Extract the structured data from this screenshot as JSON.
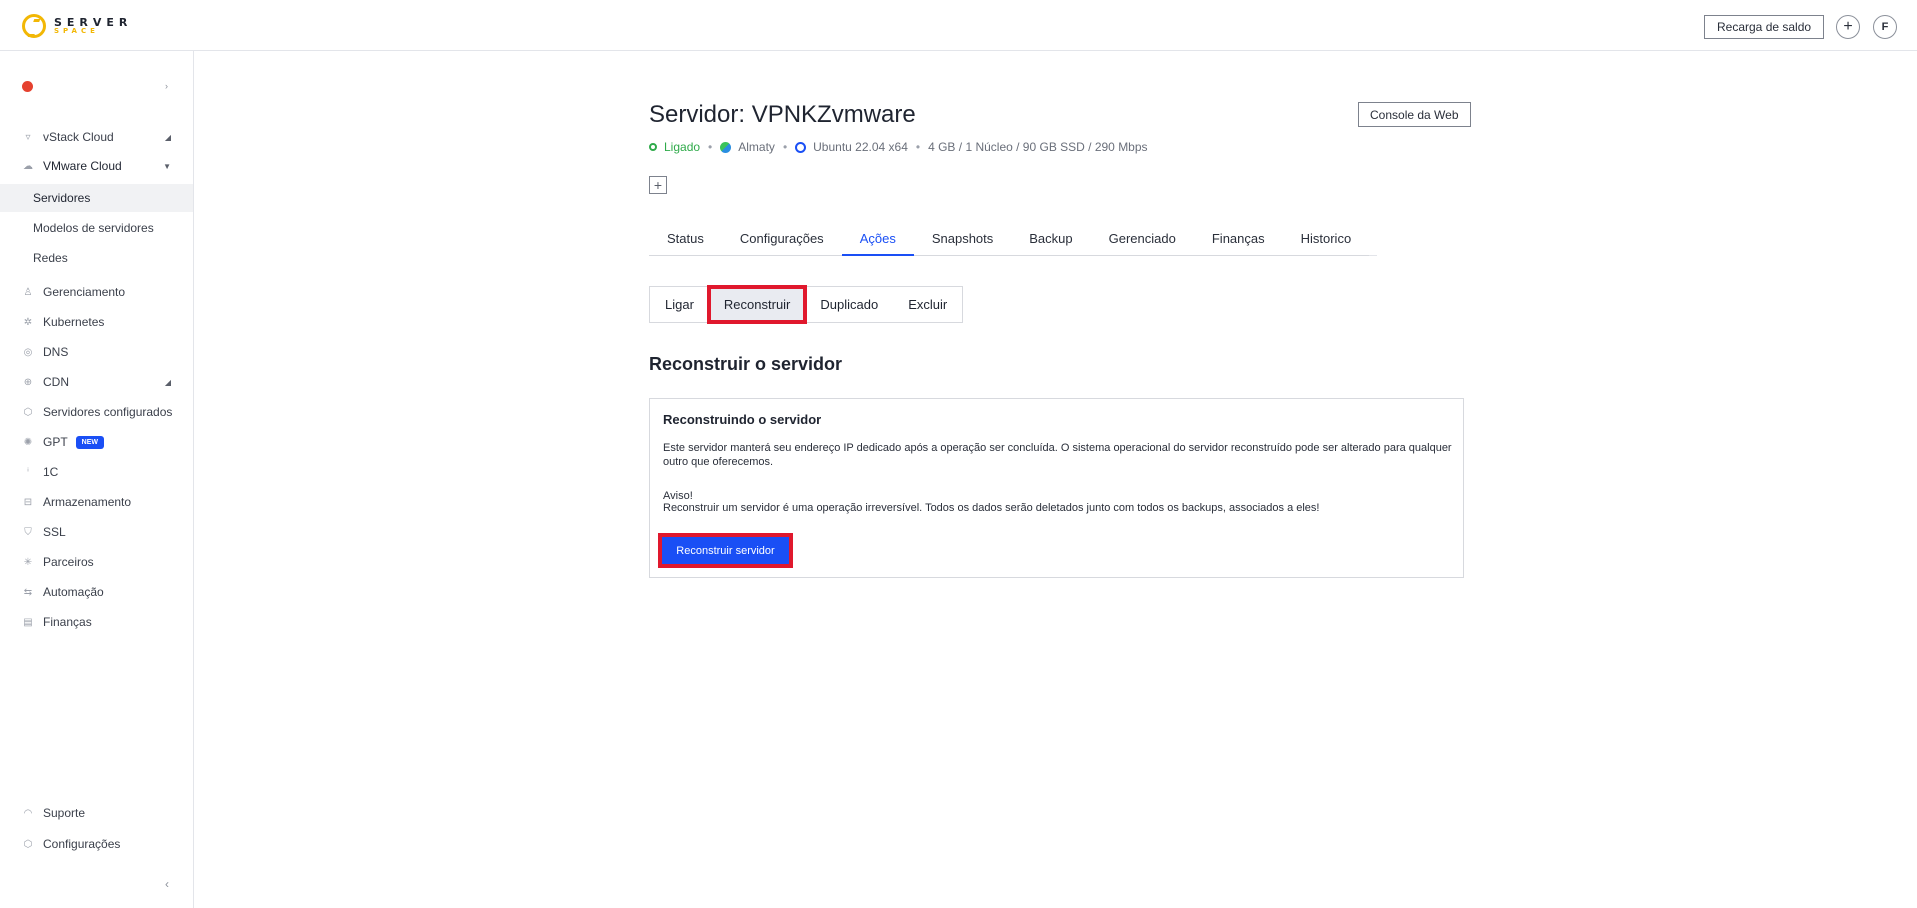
{
  "header": {
    "logo_top": "SERVER",
    "logo_bottom": "SPACE",
    "recharge_label": "Recarga de saldo",
    "plus_symbol": "+",
    "avatar_initial": "F"
  },
  "sidebar": {
    "items": [
      {
        "label": "vStack Cloud",
        "icon": "vstack-icon"
      },
      {
        "label": "VMware Cloud",
        "icon": "cloud-icon"
      },
      {
        "label": "Servidores"
      },
      {
        "label": "Modelos de servidores"
      },
      {
        "label": "Redes"
      },
      {
        "label": "Gerenciamento",
        "icon": "user-icon"
      },
      {
        "label": "Kubernetes",
        "icon": "kubernetes-icon"
      },
      {
        "label": "DNS",
        "icon": "dns-icon"
      },
      {
        "label": "CDN",
        "icon": "globe-icon"
      },
      {
        "label": "Servidores configurados",
        "icon": "box-icon"
      },
      {
        "label": "GPT",
        "icon": "gpt-icon",
        "badge": "NEW"
      },
      {
        "label": "1C",
        "icon": "1c-icon"
      },
      {
        "label": "Armazenamento",
        "icon": "storage-icon"
      },
      {
        "label": "SSL",
        "icon": "shield-icon"
      },
      {
        "label": "Parceiros",
        "icon": "partners-icon"
      },
      {
        "label": "Automação",
        "icon": "automation-icon"
      },
      {
        "label": "Finanças",
        "icon": "finance-icon"
      }
    ],
    "footer": [
      {
        "label": "Suporte",
        "icon": "headset-icon"
      },
      {
        "label": "Configurações",
        "icon": "settings-icon"
      }
    ]
  },
  "server": {
    "title": "Servidor: VPNKZvmware",
    "console_label": "Console da Web",
    "status": "Ligado",
    "location": "Almaty",
    "os": "Ubuntu 22.04 x64",
    "specs": "4 GB / 1 Núcleo / 90 GB SSD / 290 Mbps",
    "status_color": "#2faa4a"
  },
  "tabs": [
    "Status",
    "Configurações",
    "Ações",
    "Snapshots",
    "Backup",
    "Gerenciado",
    "Finanças",
    "Historico"
  ],
  "active_tab": "Ações",
  "actions": [
    "Ligar",
    "Reconstruir",
    "Duplicado",
    "Excluir"
  ],
  "active_action": "Reconstruir",
  "section": {
    "title": "Reconstruir o servidor",
    "card_title": "Reconstruindo o servidor",
    "description": "Este servidor manterá seu endereço IP dedicado após a operação ser concluída. O sistema operacional do servidor reconstruído pode ser alterado para qualquer outro que oferecemos.",
    "warning_title": "Aviso!",
    "warning_text": "Reconstruir um servidor é uma operação irreversível. Todos os dados serão deletados junto com todos os backups, associados a eles!",
    "button_label": "Reconstruir servidor"
  },
  "colors": {
    "accent": "#1a4ff5",
    "highlight": "#e0182d"
  }
}
